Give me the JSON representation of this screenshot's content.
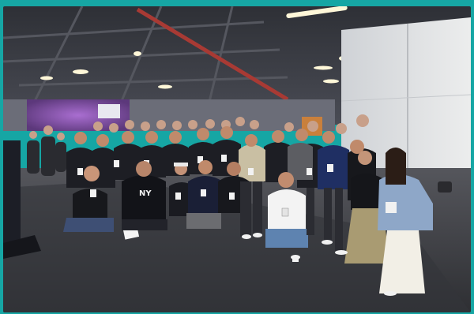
{
  "photo": {
    "jersey_print": "NY"
  },
  "colors": {
    "border": "#16a6a4",
    "ceiling": "#2a2c31",
    "floor": "#3e3f44",
    "panel": "#dfe0e2",
    "red_beam": "#a83a34",
    "purple_glow": "#9a4fc4"
  }
}
